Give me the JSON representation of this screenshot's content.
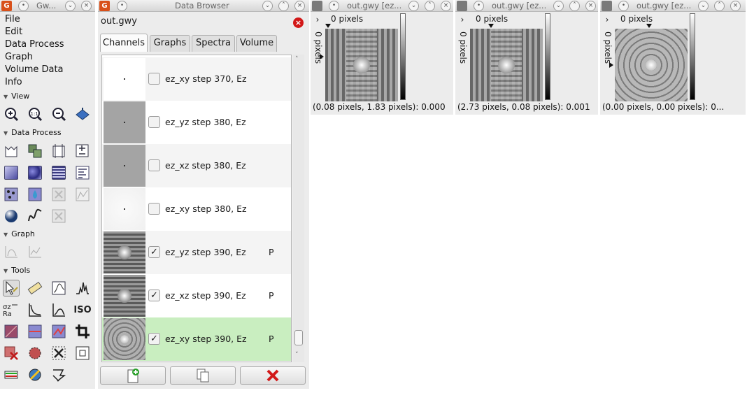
{
  "toolbox": {
    "title": "Gw...",
    "menu": [
      "File",
      "Edit",
      "Data Process",
      "Graph",
      "Volume Data",
      "Info"
    ],
    "sections": [
      "View",
      "Data Process",
      "Graph",
      "Tools"
    ],
    "tool_iso_label": "ISO"
  },
  "browser": {
    "title": "Data Browser",
    "file": "out.gwy",
    "tabs": [
      "Channels",
      "Graphs",
      "Spectra",
      "Volume"
    ],
    "rows": [
      {
        "label": "ez_xy step 370, Ez",
        "checked": "",
        "flag": ""
      },
      {
        "label": "ez_yz step 380, Ez",
        "checked": "",
        "flag": ""
      },
      {
        "label": "ez_xz step 380, Ez",
        "checked": "",
        "flag": ""
      },
      {
        "label": "ez_xy step 380, Ez",
        "checked": "",
        "flag": ""
      },
      {
        "label": "ez_yz step 390, Ez",
        "checked": "✓",
        "flag": "P"
      },
      {
        "label": "ez_xz step 390, Ez",
        "checked": "✓",
        "flag": "P"
      },
      {
        "label": "ez_xy step 390, Ez",
        "checked": "✓",
        "flag": "P"
      }
    ]
  },
  "channel_windows": [
    {
      "title": "out.gwy [ez...",
      "ruler_top": "0 pixels",
      "ruler_left": "0 pixels",
      "coords": "(0.08 pixels, 1.83 pixels): 0.000"
    },
    {
      "title": "out.gwy [ez...",
      "ruler_top": "0 pixels",
      "ruler_left": "0 pixels",
      "coords": "(2.73 pixels, 0.08 pixels): 0.001"
    },
    {
      "title": "out.gwy [ez...",
      "ruler_top": "0 pixels",
      "ruler_left": "0 pixels",
      "coords": "(0.00 pixels, 0.00 pixels): 0..."
    }
  ],
  "colors": {
    "selection": "#c9eec0",
    "delete": "#d21818",
    "add": "#2aa02a",
    "app_icon": "#d8501a"
  }
}
